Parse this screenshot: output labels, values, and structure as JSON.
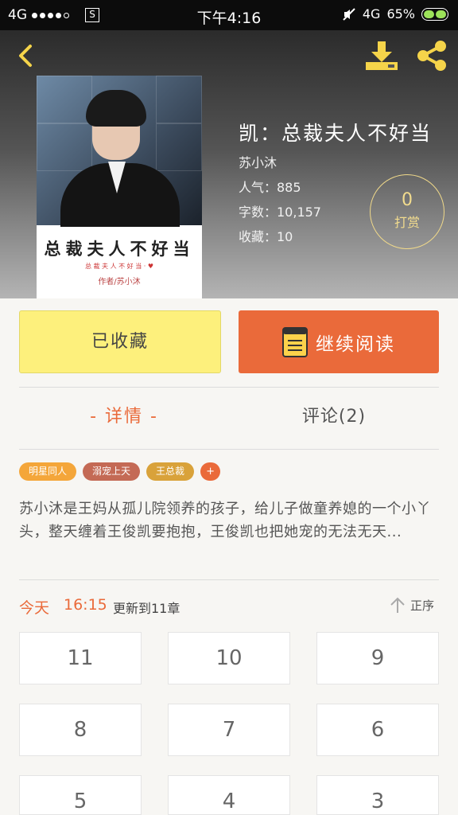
{
  "status_bar": {
    "network": "4G",
    "signal_icon": "signal-strength-icon",
    "screenshot_icon": "S",
    "time": "下午4:16",
    "net_right": "4G",
    "battery": "65%"
  },
  "header": {
    "back_icon": "chevron-left-icon",
    "download_icon": "download-icon",
    "share_icon": "share-icon",
    "accent_color": "#f5d44a"
  },
  "cover": {
    "title": "总裁夫人不好当",
    "subtitle": "总 裁 夫 人 不 好 当 · ♥",
    "author": "作者/苏小沐"
  },
  "book": {
    "title": "凯：总裁夫人不好当",
    "author": "苏小沐",
    "popularity": "人气：885",
    "word_count": "字数：10,157",
    "favorites": "收藏：10"
  },
  "reward": {
    "count": "0",
    "label": "打赏"
  },
  "actions": {
    "favorite_label": "已收藏",
    "read_label": "继续阅读"
  },
  "tabs": {
    "detail": "- 详情 -",
    "comments": "评论(2)"
  },
  "tags": [
    {
      "label": "明星同人",
      "color": "#f4a63a"
    },
    {
      "label": "溺宠上天",
      "color": "#c46a55"
    },
    {
      "label": "王总裁",
      "color": "#d9a23a"
    }
  ],
  "tag_add": "+",
  "description": "苏小沐是王妈从孤儿院领养的孩子，给儿子做童养媳的一个小丫头，整天缠着王俊凯要抱抱，王俊凯也把她宠的无法无天...",
  "update": {
    "day": "今天",
    "time": "16:15",
    "text": "更新到11章",
    "sort_label": "正序"
  },
  "chapters": [
    "11",
    "10",
    "9",
    "8",
    "7",
    "6",
    "5",
    "4",
    "3"
  ]
}
